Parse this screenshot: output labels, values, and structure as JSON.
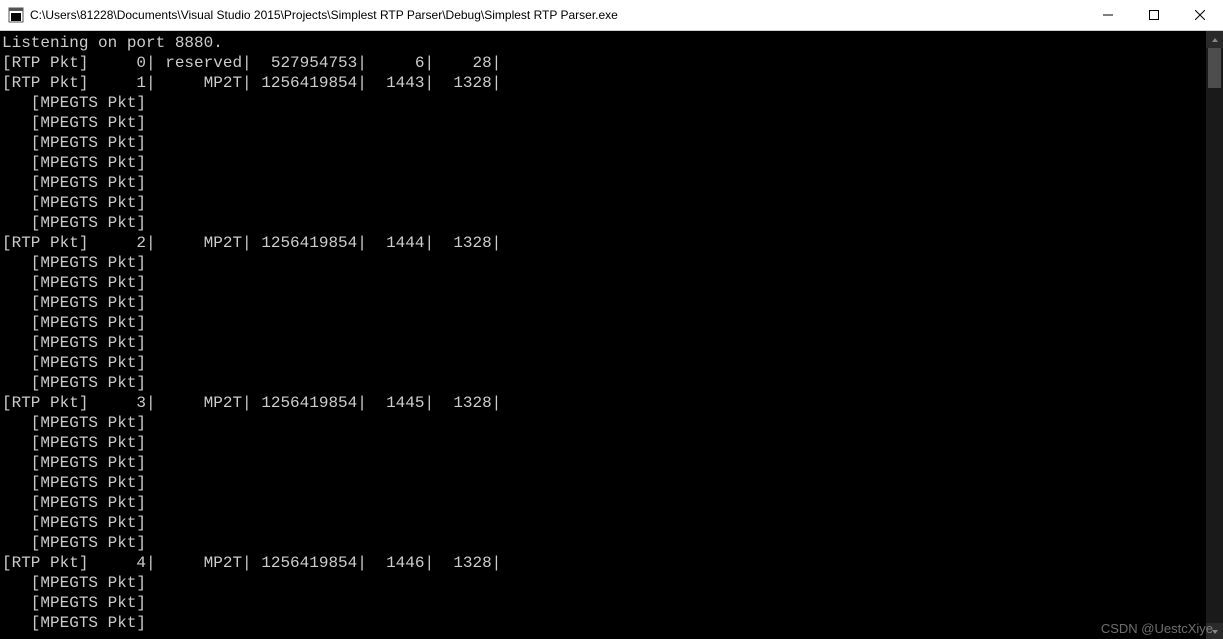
{
  "window": {
    "title": "C:\\Users\\81228\\Documents\\Visual Studio 2015\\Projects\\Simplest RTP Parser\\Debug\\Simplest RTP Parser.exe"
  },
  "header_line": "Listening on port 8880.",
  "mpegts_label": "[MPEGTS Pkt]",
  "rtp_lines": [
    {
      "label": "[RTP Pkt]",
      "idx": "0",
      "type": "reserved",
      "ssrc": "527954753",
      "seq": "6",
      "size": "28",
      "mpegts_count": 0
    },
    {
      "label": "[RTP Pkt]",
      "idx": "1",
      "type": "MP2T",
      "ssrc": "1256419854",
      "seq": "1443",
      "size": "1328",
      "mpegts_count": 7
    },
    {
      "label": "[RTP Pkt]",
      "idx": "2",
      "type": "MP2T",
      "ssrc": "1256419854",
      "seq": "1444",
      "size": "1328",
      "mpegts_count": 7
    },
    {
      "label": "[RTP Pkt]",
      "idx": "3",
      "type": "MP2T",
      "ssrc": "1256419854",
      "seq": "1445",
      "size": "1328",
      "mpegts_count": 7
    },
    {
      "label": "[RTP Pkt]",
      "idx": "4",
      "type": "MP2T",
      "ssrc": "1256419854",
      "seq": "1446",
      "size": "1328",
      "mpegts_count": 3
    }
  ],
  "watermark": "CSDN @UestcXiye"
}
